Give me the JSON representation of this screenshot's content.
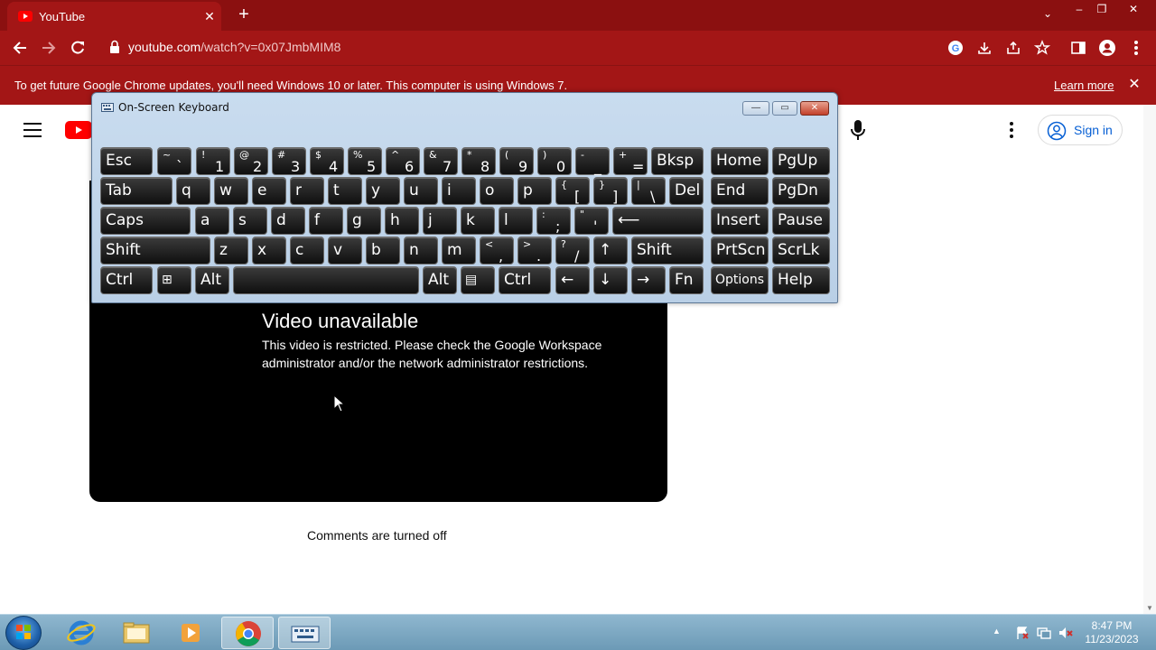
{
  "browser": {
    "tab_title": "YouTube",
    "url_host": "youtube.com",
    "url_path": "/watch?v=0x07JmbMIM8",
    "window_min": "–",
    "window_restore": "❐",
    "window_close": "✕",
    "tab_close": "✕",
    "new_tab": "+",
    "tab_search": "⌄"
  },
  "infobar": {
    "message": "To get future Google Chrome updates, you'll need Windows 10 or later. This computer is using Windows 7.",
    "link": "Learn more",
    "close": "✕"
  },
  "youtube": {
    "sign_in": "Sign in",
    "video_title": "Video unavailable",
    "video_message": "This video is restricted. Please check the Google Workspace administrator and/or the network administrator restrictions.",
    "comments": "Comments are turned off"
  },
  "osk": {
    "title": "On-Screen Keyboard",
    "minimize": "—",
    "restore": "▭",
    "close": "✕",
    "row1": [
      {
        "main": "Esc"
      },
      {
        "top": "~",
        "bot": "`"
      },
      {
        "top": "!",
        "bot": "1"
      },
      {
        "top": "@",
        "bot": "2"
      },
      {
        "top": "#",
        "bot": "3"
      },
      {
        "top": "$",
        "bot": "4"
      },
      {
        "top": "%",
        "bot": "5"
      },
      {
        "top": "^",
        "bot": "6"
      },
      {
        "top": "&",
        "bot": "7"
      },
      {
        "top": "*",
        "bot": "8"
      },
      {
        "top": "(",
        "bot": "9"
      },
      {
        "top": ")",
        "bot": "0"
      },
      {
        "top": "-",
        "bot": "_"
      },
      {
        "top": "+",
        "bot": "="
      },
      {
        "main": "Bksp"
      },
      {
        "main": "Home"
      },
      {
        "main": "PgUp"
      }
    ],
    "row2": [
      {
        "main": "Tab"
      },
      {
        "main": "q"
      },
      {
        "main": "w"
      },
      {
        "main": "e"
      },
      {
        "main": "r"
      },
      {
        "main": "t"
      },
      {
        "main": "y"
      },
      {
        "main": "u"
      },
      {
        "main": "i"
      },
      {
        "main": "o"
      },
      {
        "main": "p"
      },
      {
        "top": "{",
        "bot": "["
      },
      {
        "top": "}",
        "bot": "]"
      },
      {
        "top": "|",
        "bot": "\\"
      },
      {
        "main": "Del"
      },
      {
        "main": "End"
      },
      {
        "main": "PgDn"
      }
    ],
    "row3": [
      {
        "main": "Caps"
      },
      {
        "main": "a"
      },
      {
        "main": "s"
      },
      {
        "main": "d"
      },
      {
        "main": "f"
      },
      {
        "main": "g"
      },
      {
        "main": "h"
      },
      {
        "main": "j"
      },
      {
        "main": "k"
      },
      {
        "main": "l"
      },
      {
        "top": ":",
        "bot": ";"
      },
      {
        "top": "\"",
        "bot": "'"
      },
      {
        "main": "⟵"
      },
      {
        "main": "Insert"
      },
      {
        "main": "Pause"
      }
    ],
    "row4": [
      {
        "main": "Shift"
      },
      {
        "main": "z"
      },
      {
        "main": "x"
      },
      {
        "main": "c"
      },
      {
        "main": "v"
      },
      {
        "main": "b"
      },
      {
        "main": "n"
      },
      {
        "main": "m"
      },
      {
        "top": "<",
        "bot": ","
      },
      {
        "top": ">",
        "bot": "."
      },
      {
        "top": "?",
        "bot": "/"
      },
      {
        "main": "↑"
      },
      {
        "main": "Shift"
      },
      {
        "main": "PrtScn"
      },
      {
        "main": "ScrLk"
      }
    ],
    "row5": [
      {
        "main": "Ctrl"
      },
      {
        "main": "⊞"
      },
      {
        "main": "Alt"
      },
      {
        "main": ""
      },
      {
        "main": "Alt"
      },
      {
        "main": "▤"
      },
      {
        "main": "Ctrl"
      },
      {
        "main": "←"
      },
      {
        "main": "↓"
      },
      {
        "main": "→"
      },
      {
        "main": "Fn"
      },
      {
        "main": "Options"
      },
      {
        "main": "Help"
      }
    ]
  },
  "taskbar": {
    "time": "8:47 PM",
    "date": "11/23/2023",
    "tray_expand": "▲"
  }
}
